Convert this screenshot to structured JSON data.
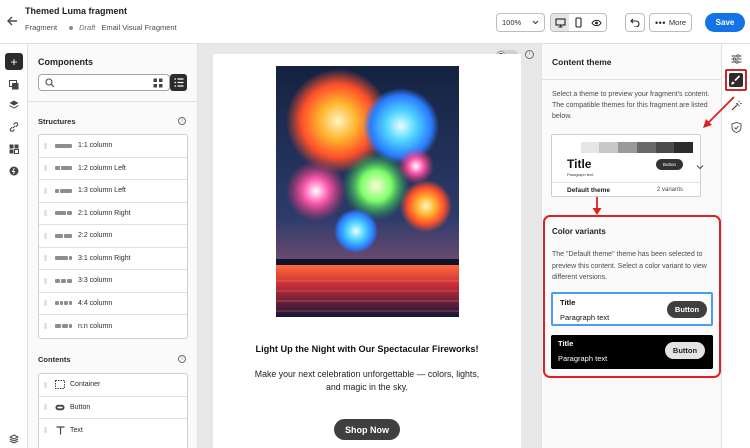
{
  "header": {
    "title": "Themed Luma fragment",
    "type_label": "Fragment",
    "status": "Draft",
    "fragment_kind": "Email Visual Fragment",
    "zoom": "100%",
    "more_label": "More",
    "save_label": "Save"
  },
  "components": {
    "title": "Components",
    "search_placeholder": "",
    "structures_label": "Structures",
    "structures": [
      {
        "label": "1:1 column",
        "cols": [
          1
        ]
      },
      {
        "label": "1:2 column Left",
        "cols": [
          1,
          2
        ]
      },
      {
        "label": "1:3 column Left",
        "cols": [
          1,
          3
        ]
      },
      {
        "label": "2:1 column Right",
        "cols": [
          2,
          1
        ]
      },
      {
        "label": "2:2 column",
        "cols": [
          1,
          1
        ]
      },
      {
        "label": "3:1 column Right",
        "cols": [
          3,
          1
        ]
      },
      {
        "label": "3:3 column",
        "cols": [
          1,
          1,
          1
        ]
      },
      {
        "label": "4:4 column",
        "cols": [
          1,
          1,
          1,
          1
        ]
      },
      {
        "label": "n:n column",
        "cols": [
          1,
          1,
          0.5
        ]
      }
    ],
    "contents_label": "Contents",
    "contents": [
      {
        "label": "Container",
        "icon": "container-icon"
      },
      {
        "label": "Button",
        "icon": "button-icon"
      },
      {
        "label": "Text",
        "icon": "text-icon"
      }
    ]
  },
  "canvas": {
    "headline": "Light Up the Night with Our Spectacular Fireworks!",
    "body": "Make your next celebration unforgettable — colors, lights, and magic in the sky.",
    "cta": "Shop Now",
    "image_subject": "fireworks-over-water"
  },
  "content_theme": {
    "title": "Content theme",
    "description": "Select a theme to preview your fragment's content. The compatible themes for this fragment are listed below.",
    "theme_card": {
      "swatches": [
        "#ffffff",
        "#e6e6e6",
        "#c8c8c8",
        "#9a9a9a",
        "#6a6a6a",
        "#4a4a4a",
        "#2c2c2c"
      ],
      "preview_title": "Title",
      "preview_paragraph": "Paragraph text",
      "preview_button": "Button",
      "name": "Default theme",
      "variants": "2 variants"
    },
    "color_variants_title": "Color variants",
    "color_variants_desc": "The \"Default theme\" theme has been selected to preview this content. Select a color variant to view different versions.",
    "variants": [
      {
        "title": "Title",
        "paragraph": "Paragraph text",
        "button": "Button",
        "selected": true
      },
      {
        "title": "Title",
        "paragraph": "Paragraph text",
        "button": "Button",
        "selected": false
      }
    ]
  },
  "colors": {
    "accent": "#1473e6",
    "highlight": "#e02020"
  }
}
